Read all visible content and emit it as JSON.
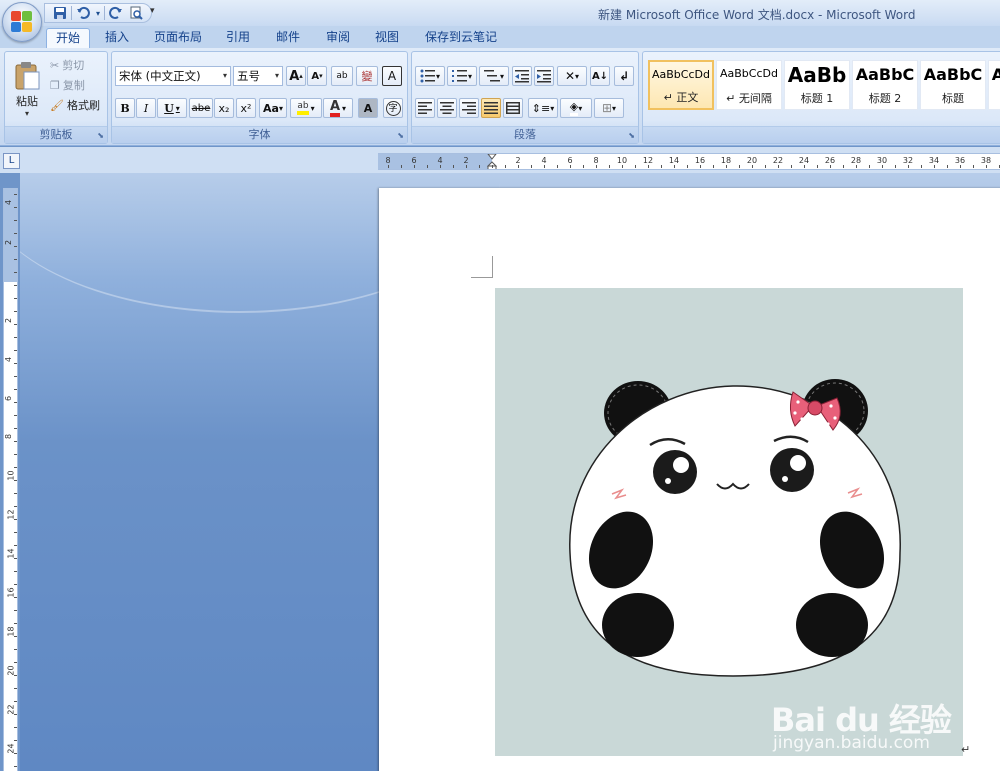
{
  "app": {
    "title": "新建 Microsoft Office Word 文档.docx - Microsoft Word"
  },
  "qat": {
    "save": "💾",
    "undo": "↶",
    "redo": "↻",
    "print_preview": "🔍",
    "more": "▾"
  },
  "tabs": [
    "开始",
    "插入",
    "页面布局",
    "引用",
    "邮件",
    "审阅",
    "视图",
    "保存到云笔记"
  ],
  "clipboard": {
    "paste": "粘贴",
    "cut": "剪切",
    "copy": "复制",
    "format_painter": "格式刷",
    "group": "剪贴板"
  },
  "font": {
    "name": "宋体 (中文正文)",
    "size": "五号",
    "grow": "A",
    "shrink": "A",
    "clear": "ab",
    "phonetic": "變",
    "border": "A",
    "bold": "B",
    "italic": "I",
    "underline": "U",
    "strike": "abe",
    "sub": "x₂",
    "sup": "x²",
    "case": "Aa",
    "highlight": "ab",
    "color": "A",
    "shade": "A",
    "enclose": "字",
    "group": "字体"
  },
  "paragraph": {
    "group": "段落"
  },
  "styles": [
    {
      "sample": "AaBbCcDd",
      "name": "↵ 正文"
    },
    {
      "sample": "AaBbCcDd",
      "name": "↵ 无间隔"
    },
    {
      "sample": "AaBb",
      "name": "标题 1"
    },
    {
      "sample": "AaBbC",
      "name": "标题 2"
    },
    {
      "sample": "AaBbC",
      "name": "标题"
    },
    {
      "sample": "A",
      "name": ""
    }
  ],
  "ruler": {
    "corner": "L",
    "left_numbers": [
      "8",
      "6",
      "4",
      "2"
    ],
    "right_numbers": [
      "2",
      "4",
      "6",
      "8",
      "10",
      "12",
      "14",
      "16",
      "18",
      "20",
      "22",
      "24",
      "26",
      "28",
      "30",
      "32",
      "34",
      "36",
      "38"
    ],
    "vertical_numbers": [
      "4",
      "2",
      "2",
      "4",
      "6",
      "8",
      "10",
      "12",
      "14",
      "16",
      "18",
      "20",
      "22",
      "24"
    ]
  },
  "watermark": {
    "main": "Bai du 经验",
    "sub": "jingyan.baidu.com"
  },
  "doc": {
    "para_mark": "↵"
  },
  "colors": {
    "ribbon": "#dfeaf8",
    "workspace": "#6b92c8",
    "picture_bg": "#c9d8d7",
    "bow": "#e8607a"
  }
}
